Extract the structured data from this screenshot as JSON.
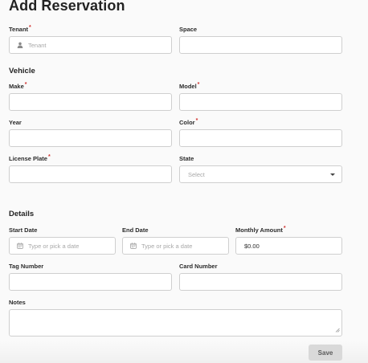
{
  "page": {
    "title": "Add Reservation"
  },
  "tenant": {
    "label": "Tenant",
    "required": "*",
    "placeholder": "Tenant",
    "icon": "person-icon"
  },
  "space": {
    "label": "Space",
    "value": ""
  },
  "vehicle": {
    "section_title": "Vehicle",
    "make": {
      "label": "Make",
      "required": "*",
      "value": ""
    },
    "model": {
      "label": "Model",
      "required": "*",
      "value": ""
    },
    "year": {
      "label": "Year",
      "value": ""
    },
    "color": {
      "label": "Color",
      "required": "*",
      "value": ""
    },
    "license_plate": {
      "label": "License Plate",
      "required": "*",
      "value": ""
    },
    "state": {
      "label": "State",
      "placeholder": "Select"
    }
  },
  "details": {
    "section_title": "Details",
    "start_date": {
      "label": "Start Date",
      "placeholder": "Type or pick a date",
      "icon": "calendar-icon"
    },
    "end_date": {
      "label": "End Date",
      "placeholder": "Type or pick a date",
      "icon": "calendar-icon"
    },
    "monthly_amount": {
      "label": "Monthly Amount",
      "required": "*",
      "value": "$0.00"
    },
    "tag_number": {
      "label": "Tag Number",
      "value": ""
    },
    "card_number": {
      "label": "Card Number",
      "value": ""
    },
    "notes": {
      "label": "Notes",
      "value": ""
    }
  },
  "actions": {
    "save_label": "Save"
  },
  "colors": {
    "required": "#d0312d",
    "background": "#fafafa",
    "field_border": "#cfcfcf",
    "save_bg": "#d9d9d9"
  }
}
